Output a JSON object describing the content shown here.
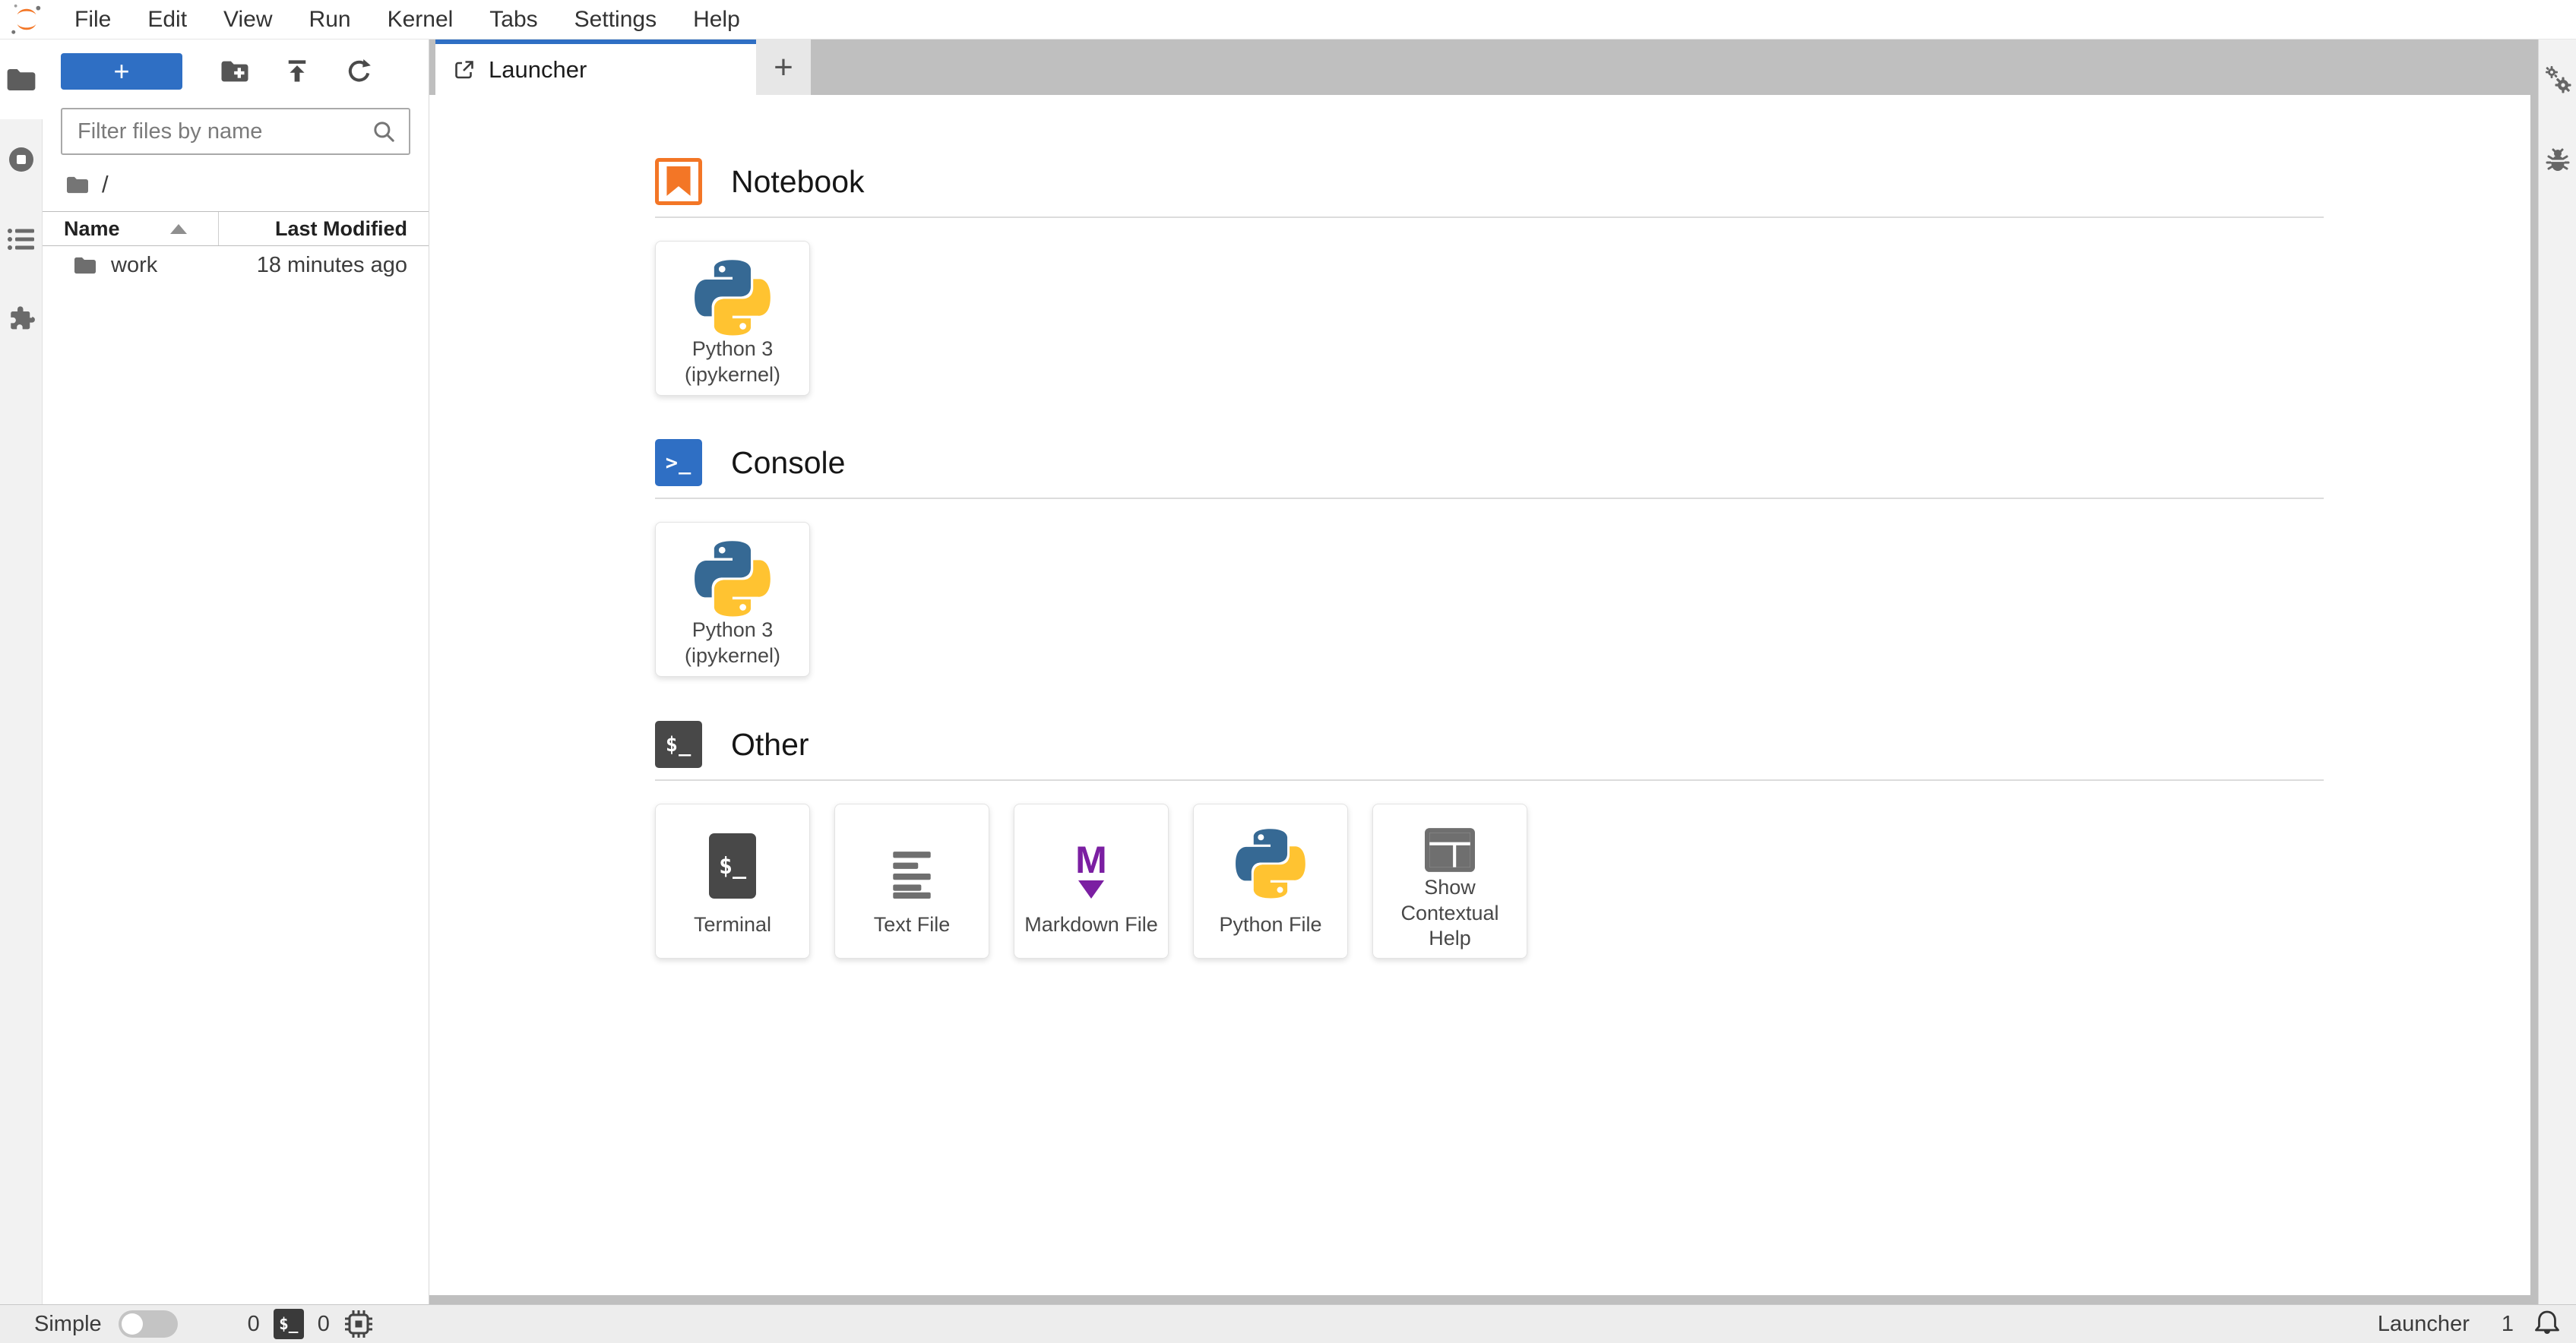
{
  "menu_bar": {
    "items": [
      {
        "label": "File"
      },
      {
        "label": "Edit"
      },
      {
        "label": "View"
      },
      {
        "label": "Run"
      },
      {
        "label": "Kernel"
      },
      {
        "label": "Tabs"
      },
      {
        "label": "Settings"
      },
      {
        "label": "Help"
      }
    ]
  },
  "left_activity_bar": {
    "items": [
      {
        "icon": "folder-icon",
        "active": true
      },
      {
        "icon": "running-sessions-icon",
        "active": false
      },
      {
        "icon": "table-of-contents-icon",
        "active": false
      },
      {
        "icon": "extension-manager-icon",
        "active": false
      }
    ]
  },
  "right_activity_bar": {
    "items": [
      {
        "icon": "property-inspector-icon"
      },
      {
        "icon": "debugger-icon"
      }
    ]
  },
  "file_browser": {
    "toolbar": {
      "new_launcher_label": "+",
      "icons": [
        {
          "icon": "new-folder-icon"
        },
        {
          "icon": "upload-icon"
        },
        {
          "icon": "refresh-icon"
        }
      ]
    },
    "filter": {
      "placeholder": "Filter files by name",
      "icon": "search-icon"
    },
    "breadcrumb": {
      "root": "/"
    },
    "listing": {
      "columns": [
        {
          "label": "Name"
        },
        {
          "label": "Last Modified"
        }
      ],
      "sort": "ascending",
      "rows": [
        {
          "icon": "folder-icon",
          "name": "work",
          "modified": "18 minutes ago"
        }
      ]
    }
  },
  "tab_bar": {
    "tabs": [
      {
        "label": "Launcher",
        "icon": "launcher-icon",
        "active": true
      }
    ],
    "add_tab_label": "+"
  },
  "launcher": {
    "sections": [
      {
        "title": "Notebook",
        "icon": "notebook-icon",
        "cards": [
          {
            "label": "Python 3 (ipykernel)",
            "icon": "python-logo-icon"
          }
        ]
      },
      {
        "title": "Console",
        "icon": "console-icon",
        "icon_glyph": ">_",
        "cards": [
          {
            "label": "Python 3 (ipykernel)",
            "icon": "python-logo-icon"
          }
        ]
      },
      {
        "title": "Other",
        "icon": "terminal-icon",
        "icon_glyph": "$_",
        "cards": [
          {
            "label": "Terminal",
            "icon": "terminal-icon",
            "icon_glyph": "$_"
          },
          {
            "label": "Text File",
            "icon": "text-file-icon"
          },
          {
            "label": "Markdown File",
            "icon": "markdown-icon",
            "icon_glyph": "M"
          },
          {
            "label": "Python File",
            "icon": "python-logo-icon"
          },
          {
            "label": "Show Contextual Help",
            "icon": "contextual-help-icon"
          }
        ]
      }
    ]
  },
  "status_bar": {
    "mode": {
      "label": "Simple",
      "toggle": "off"
    },
    "sessions": {
      "terminals_count": "0",
      "terminal_glyph": "$_",
      "kernels_count": "0",
      "kernel_icon": "kernel-chip-icon"
    },
    "right": {
      "context_label": "Launcher",
      "notifications_count": "1",
      "icon": "bell-icon"
    }
  },
  "colors": {
    "accent_blue": "#2f6fc4",
    "jupyter_orange": "#f37626",
    "markdown_purple": "#7b1fa2",
    "terminal_dark": "#484848",
    "python_blue": "#366994",
    "python_yellow": "#ffc331",
    "dock_gray": "#bfbfbf"
  }
}
